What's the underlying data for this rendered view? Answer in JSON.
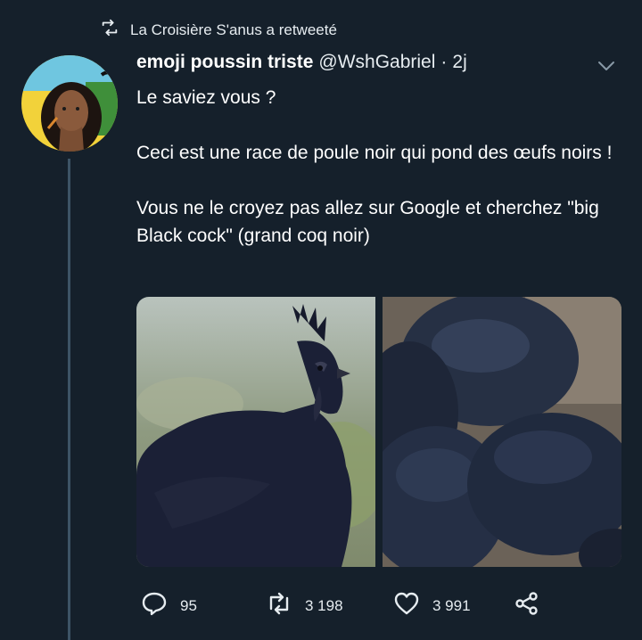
{
  "retweet_banner": {
    "text": "La Croisière S'anus a retweeté",
    "icon": "retweet-icon"
  },
  "tweet": {
    "author_name": "emoji poussin triste",
    "handle": "@WshGabriel",
    "separator": "·",
    "time": "2j",
    "paragraphs": [
      "Le saviez vous ?",
      "Ceci est une race de poule noir qui pond des œufs noirs !",
      "Vous ne le croyez pas allez sur Google et cherchez \"big Black cock\" (grand coq noir)"
    ],
    "media": [
      {
        "name": "black-rooster-photo"
      },
      {
        "name": "black-eggs-photo"
      }
    ]
  },
  "actions": {
    "replies": "95",
    "retweets": "3 198",
    "likes": "3 991"
  },
  "colors": {
    "background": "#15202b",
    "text": "#ffffff",
    "secondary": "#e6ecf0",
    "thread_line": "#3d5466"
  }
}
